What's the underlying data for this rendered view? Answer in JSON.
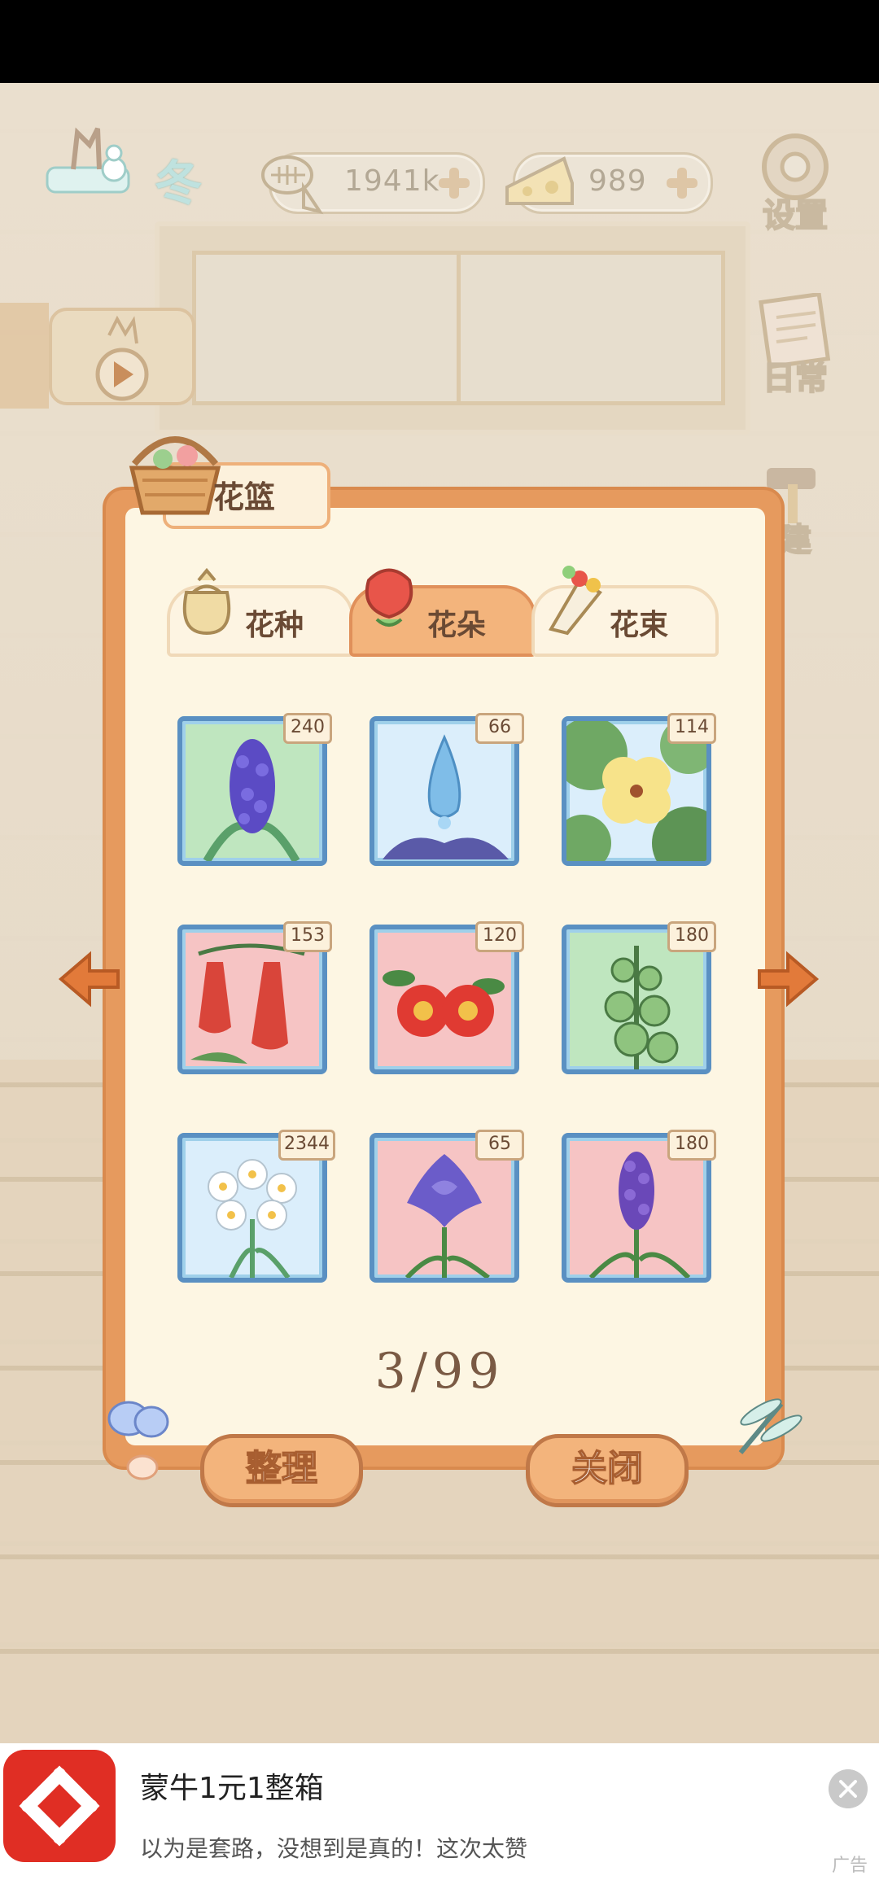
{
  "hud": {
    "season": "冬",
    "fish_currency": "1941k",
    "cheese_currency": "989",
    "settings_label": "设置",
    "daily_label": "日常",
    "build_label": "建"
  },
  "dialog": {
    "title": "花篮",
    "tabs": [
      {
        "label": "花种",
        "active": false
      },
      {
        "label": "花朵",
        "active": true
      },
      {
        "label": "花束",
        "active": false
      }
    ],
    "items": [
      {
        "name": "hyacinth",
        "count": "240",
        "bg": "#bfe6bf"
      },
      {
        "name": "crystal-flower",
        "count": "66",
        "bg": "#dbeefb"
      },
      {
        "name": "yellow-flower",
        "count": "114",
        "bg": "#dbeefb"
      },
      {
        "name": "bell-flower",
        "count": "153",
        "bg": "#f6c4c4"
      },
      {
        "name": "red-camellia",
        "count": "120",
        "bg": "#f6c4c4"
      },
      {
        "name": "green-bells",
        "count": "180",
        "bg": "#bfe6bf"
      },
      {
        "name": "white-daffodil",
        "count": "2344",
        "bg": "#dbeefb"
      },
      {
        "name": "purple-iris",
        "count": "65",
        "bg": "#f6c4c4"
      },
      {
        "name": "grape-hyacinth",
        "count": "180",
        "bg": "#f6c4c4"
      }
    ],
    "page_indicator": "3/99",
    "sort_button": "整理",
    "close_button": "关闭"
  },
  "ad": {
    "title": "蒙牛1元1整箱",
    "description": "以为是套路，没想到是真的！这次太赞",
    "tag": "广告"
  }
}
